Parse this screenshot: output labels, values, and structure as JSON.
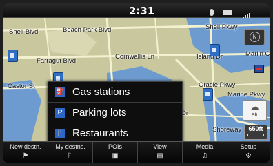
{
  "status": {
    "time": "2:31"
  },
  "map": {
    "streets": [
      "Shell Blvd",
      "Beach Park Blvd",
      "Shell Pkwy",
      "Farragut Blvd",
      "Cornwallis Ln",
      "Island Dr",
      "Marlin Ct",
      "Castor St",
      "Oracle Pkwy",
      "Marine Pkwy",
      "Dr",
      "Shoreway"
    ],
    "compass_label": "N",
    "weather_temp": "9ft",
    "scale_label": "650ft"
  },
  "poi_menu": {
    "items": [
      {
        "label": "Gas stations",
        "icon": "gas-station-icon",
        "glyph": "⛽"
      },
      {
        "label": "Parking lots",
        "icon": "parking-icon",
        "glyph": "P"
      },
      {
        "label": "Restaurants",
        "icon": "restaurant-icon",
        "glyph": "🍴"
      }
    ]
  },
  "nav": {
    "buttons": [
      {
        "label": "New destn.",
        "icon": "flag-icon"
      },
      {
        "label": "My destns.",
        "icon": "route-icon"
      },
      {
        "label": "POIs",
        "icon": "poi-icon"
      },
      {
        "label": "View",
        "icon": "map-view-icon"
      },
      {
        "label": "Media",
        "icon": "music-note-icon"
      },
      {
        "label": "Setup",
        "icon": "settings-icon"
      }
    ]
  },
  "colors": {
    "map_land": "#c8c79e",
    "map_water": "#6d9bd0",
    "poi_blue": "#2d66c9"
  }
}
